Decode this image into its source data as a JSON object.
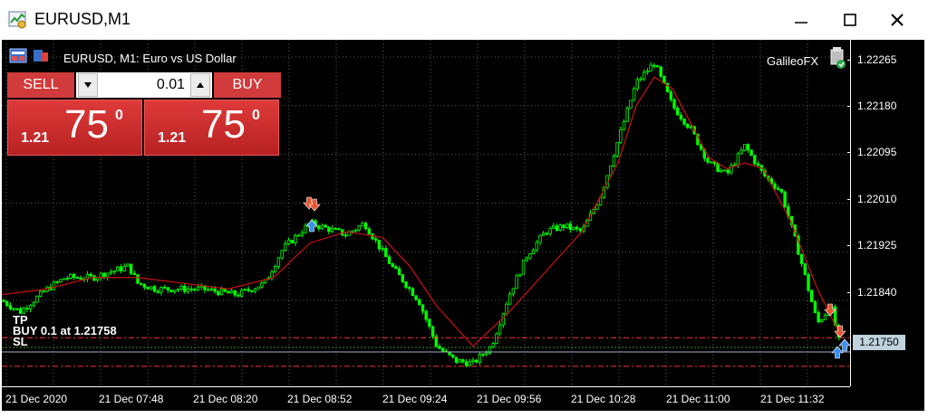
{
  "window": {
    "title": "EURUSD,M1"
  },
  "chart": {
    "symbol_info": "EURUSD, M1:  Euro vs US Dollar",
    "indicator_name": "GalileoFX",
    "price_labels": [
      "1.22265",
      "1.22180",
      "1.22095",
      "1.22010",
      "1.21925",
      "1.21840"
    ],
    "current_price": "1.21750",
    "time_labels": [
      "21 Dec 2020",
      "21 Dec 07:48",
      "21 Dec 08:20",
      "21 Dec 08:52",
      "21 Dec 09:24",
      "21 Dec 09:56",
      "21 Dec 10:28",
      "21 Dec 11:00",
      "21 Dec 11:32"
    ],
    "orders": {
      "tp": "TP",
      "buy": "BUY 0.1 at 1.21758",
      "sl": "SL"
    },
    "colors": {
      "background": "#000000",
      "candle": "#00ff00",
      "ma": "#cc1111",
      "levels": "#ff3333",
      "buy_arrow": "#3b8ef0",
      "sell_arrow": "#e8552f"
    }
  },
  "trade_panel": {
    "sell_label": "SELL",
    "buy_label": "BUY",
    "lot_value": "0.01",
    "sell_price": {
      "prefix": "1.21",
      "big": "75",
      "sup": "0"
    },
    "buy_price": {
      "prefix": "1.21",
      "big": "75",
      "sup": "0"
    }
  },
  "chart_data": {
    "type": "line",
    "series": [
      {
        "x": [
          0,
          20,
          50,
          70,
          100,
          140,
          150,
          170,
          220,
          260,
          290,
          310,
          330,
          340,
          360,
          380,
          400,
          410,
          430,
          460,
          480,
          500,
          520,
          540,
          560,
          580,
          600,
          620,
          640,
          660,
          680,
          700,
          720,
          740,
          760,
          780,
          800,
          820,
          840,
          860,
          880,
          900,
          915,
          925
        ],
        "values": [
          1.2184,
          1.2182,
          1.2186,
          1.2188,
          1.2188,
          1.219,
          1.2187,
          1.2186,
          1.2186,
          1.2185,
          1.2187,
          1.2193,
          1.2196,
          1.21975,
          1.21965,
          1.21955,
          1.21975,
          1.2195,
          1.219,
          1.2184,
          1.2176,
          1.21735,
          1.2173,
          1.2176,
          1.2185,
          1.2192,
          1.2196,
          1.2197,
          1.2196,
          1.2202,
          1.2212,
          1.2222,
          1.22255,
          1.2218,
          1.2214,
          1.2208,
          1.2206,
          1.2211,
          1.2206,
          1.2203,
          1.2192,
          1.218,
          1.2183,
          1.21758
        ]
      },
      {
        "x": [
          0,
          50,
          100,
          150,
          200,
          250,
          300,
          340,
          380,
          420,
          450,
          480,
          520,
          560,
          600,
          640,
          680,
          700,
          720,
          740,
          760,
          780,
          800,
          820,
          840,
          870,
          900,
          925
        ],
        "values": [
          1.2185,
          1.2186,
          1.2188,
          1.2188,
          1.2187,
          1.2186,
          1.2188,
          1.2194,
          1.2196,
          1.2195,
          1.219,
          1.2183,
          1.2176,
          1.2182,
          1.2189,
          1.2196,
          1.2208,
          1.2218,
          1.2223,
          1.2221,
          1.2215,
          1.2209,
          1.2207,
          1.2208,
          1.2207,
          1.2198,
          1.2186,
          1.2178
        ]
      }
    ],
    "ylim": [
      1.2169,
      1.22295
    ],
    "ticks": [
      1.22265,
      1.2218,
      1.22095,
      1.2201,
      1.21925,
      1.2184,
      1.2175
    ],
    "grid": true,
    "levels": {
      "tp": 1.21775,
      "buy": 1.21758,
      "sl": 1.21725
    }
  }
}
